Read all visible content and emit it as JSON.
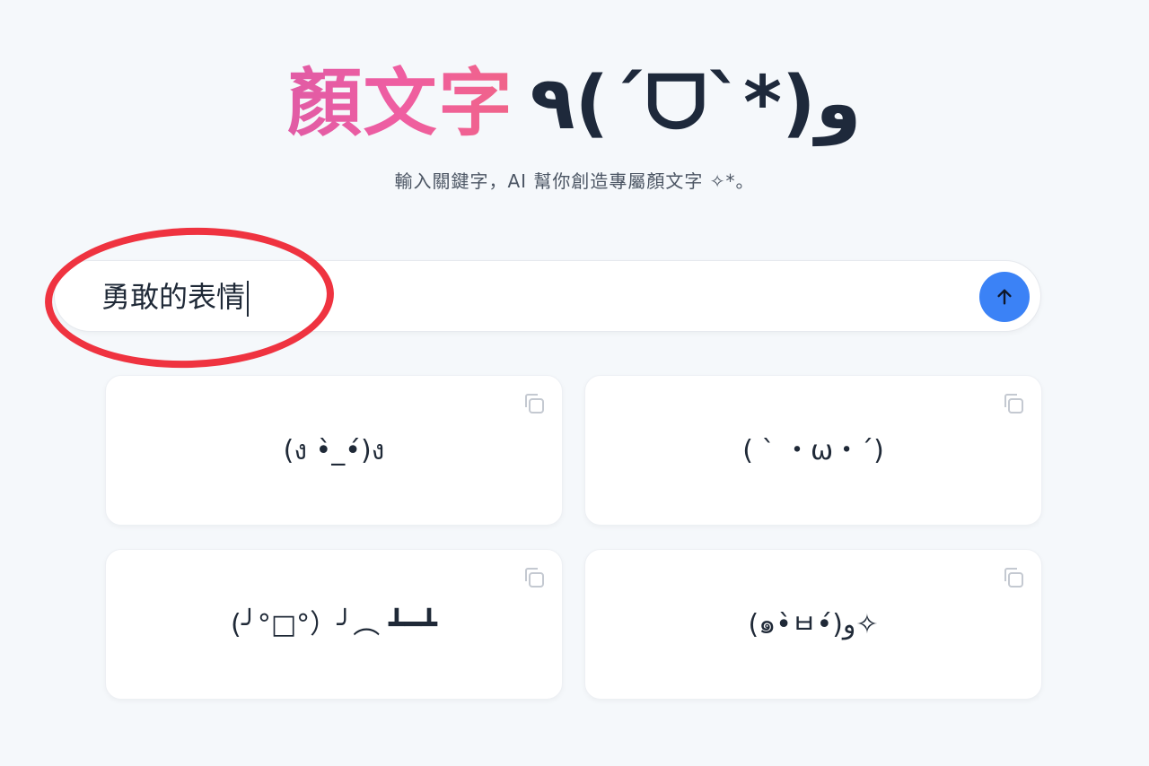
{
  "header": {
    "title_main": "顏文字",
    "title_face": "٩(ˊᗜˋ*)و",
    "subtitle": "輸入關鍵字，AI 幫你創造專屬顏文字 ✧*。"
  },
  "search": {
    "value": "勇敢的表情",
    "submit_icon": "arrow-up-icon"
  },
  "results": [
    {
      "kaomoji": "(ง •̀_•́)ง",
      "copy_icon": "copy-icon"
    },
    {
      "kaomoji": "( ˋ ・ω・ˊ)",
      "copy_icon": "copy-icon"
    },
    {
      "kaomoji": "(╯°□°）╯︵ ┻━┻",
      "copy_icon": "copy-icon"
    },
    {
      "kaomoji": "(๑•̀ㅂ•́)و✧",
      "copy_icon": "copy-icon"
    }
  ],
  "colors": {
    "accent": "#3b82f6",
    "gradient_start": "#e15ba5",
    "gradient_end": "#f06488",
    "annotation": "#ef3340",
    "background": "#f5f8fb"
  }
}
